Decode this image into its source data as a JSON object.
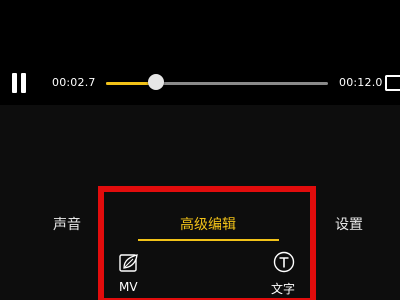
{
  "player": {
    "current_time": "00:02.7",
    "total_time": "00:12.0",
    "progress": 0.225,
    "state": "playing",
    "pause_icon": "pause-icon",
    "fullscreen_icon": "fullscreen-icon"
  },
  "tabs": [
    {
      "label": "声音",
      "active": false
    },
    {
      "label": "高级编辑",
      "active": true
    },
    {
      "label": "设置",
      "active": false
    }
  ],
  "tools": [
    {
      "label": "MV",
      "icon": "mv-leaf-icon"
    },
    {
      "label": "文字",
      "icon": "text-t-icon"
    }
  ],
  "colors": {
    "accent": "#f2c218",
    "highlight": "#e10c0c",
    "background": "#000000"
  }
}
